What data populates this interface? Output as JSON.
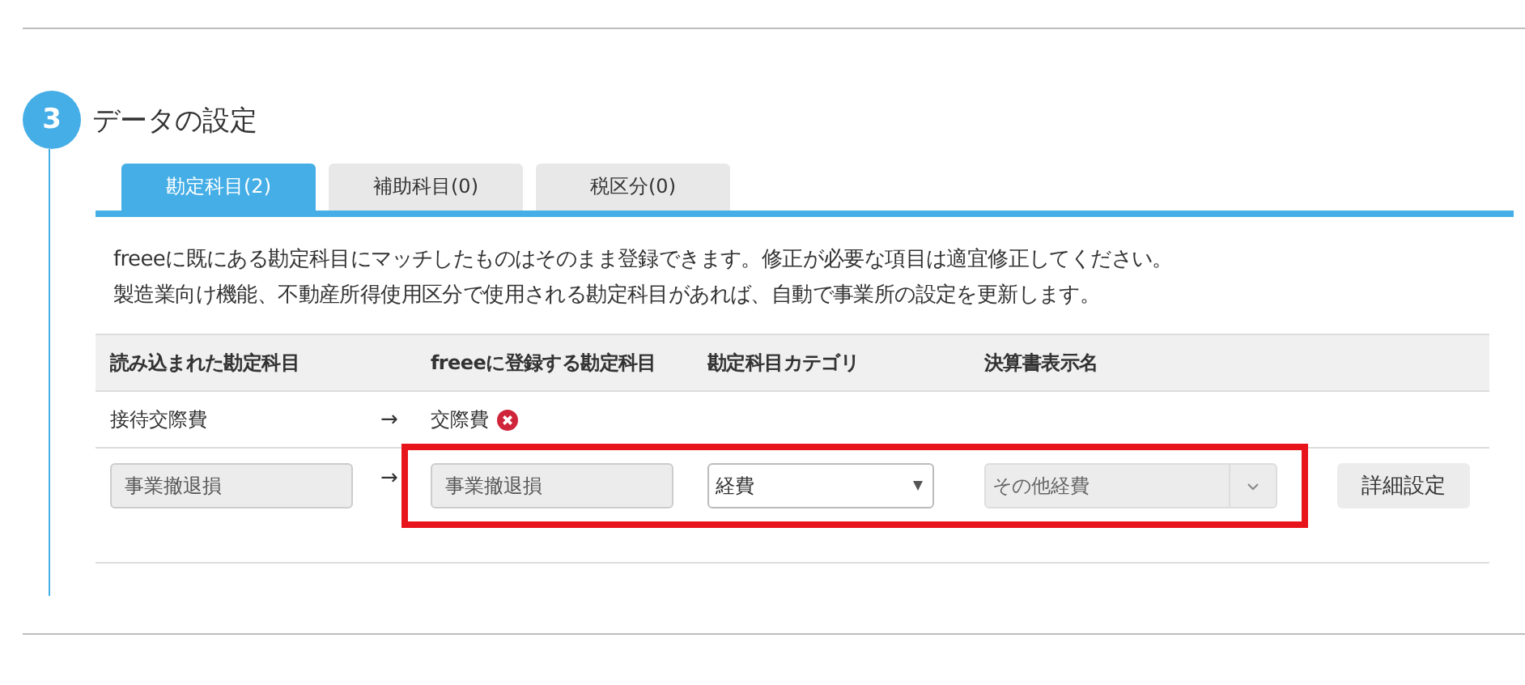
{
  "section": {
    "step": "3",
    "title": "データの設定"
  },
  "tabs": [
    {
      "label": "勘定科目(2)",
      "selected": true
    },
    {
      "label": "補助科目(0)",
      "selected": false
    },
    {
      "label": "税区分(0)",
      "selected": false
    }
  ],
  "description": [
    "freeeに既にある勘定科目にマッチしたものはそのまま登録できます。修正が必要な項目は適宜修正してください。",
    "製造業向け機能、不動産所得使用区分で使用される勘定科目があれば、自動で事業所の設定を更新します。"
  ],
  "table": {
    "columns": [
      "読み込まれた勘定科目",
      "freeeに登録する勘定科目",
      "勘定科目カテゴリ",
      "決算書表示名"
    ],
    "arrow": "→",
    "rows": [
      {
        "kind": "text",
        "source": "接待交際費",
        "target": "交際費",
        "error": true,
        "highlighted": false
      },
      {
        "kind": "edit",
        "source": "事業撤退損",
        "target": "事業撤退損",
        "category": "経費",
        "statement_name": "その他経費",
        "button": "詳細設定",
        "highlighted": true
      }
    ]
  }
}
